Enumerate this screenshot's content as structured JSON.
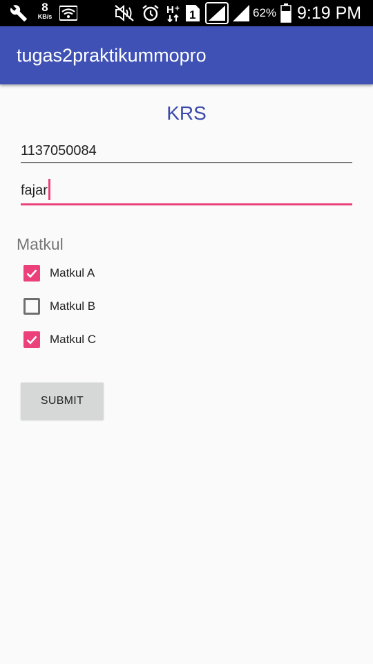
{
  "status_bar": {
    "net_speed_value": "8",
    "net_speed_unit": "KB/s",
    "battery_percent": "62%",
    "time": "9:19 PM",
    "icons": [
      "wrench-icon",
      "wifi-icon",
      "mute-icon",
      "alarm-icon",
      "h-plus-data-icon",
      "sim-1-icon",
      "signal-icon",
      "signal-icon-2",
      "battery-icon"
    ]
  },
  "app_bar": {
    "title": "tugas2praktikummopro",
    "color": "#3f51b5"
  },
  "form": {
    "heading": "KRS",
    "nim_value": "1137050084",
    "name_value": "fajar",
    "matkul_label": "Matkul",
    "checkboxes": [
      {
        "label": "Matkul A",
        "checked": true
      },
      {
        "label": "Matkul B",
        "checked": false
      },
      {
        "label": "Matkul C",
        "checked": true
      }
    ],
    "submit_label": "SUBMIT"
  },
  "colors": {
    "accent": "#ec407a",
    "primary": "#3f51b5",
    "heading": "#3949ab"
  }
}
